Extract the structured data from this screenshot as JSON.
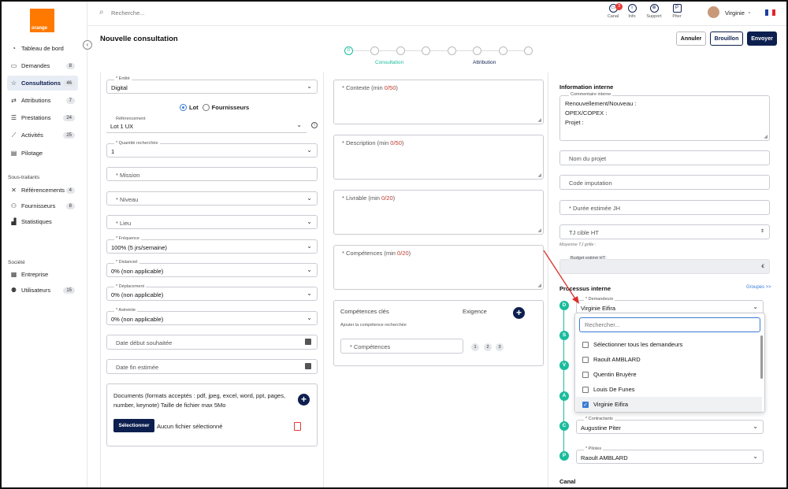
{
  "brand": {
    "logo_text": "orange",
    "accent": "#ff7900",
    "primary": "#0d1f4f",
    "teal": "#1abc9c"
  },
  "sidebar": {
    "items": [
      {
        "label": "Tableau de bord",
        "count": ""
      },
      {
        "label": "Demandes",
        "count": "8"
      },
      {
        "label": "Consultations",
        "count": "46"
      },
      {
        "label": "Attributions",
        "count": "7"
      },
      {
        "label": "Prestations",
        "count": "24"
      },
      {
        "label": "Activités",
        "count": "25"
      },
      {
        "label": "Pilotage",
        "count": ""
      }
    ],
    "section_subcontractors": "Sous-traitants",
    "sub_items": [
      {
        "label": "Référencements",
        "count": "4"
      },
      {
        "label": "Fournisseurs",
        "count": "8"
      },
      {
        "label": "Statistiques",
        "count": ""
      }
    ],
    "section_company": "Société",
    "company_items": [
      {
        "label": "Entreprise",
        "count": ""
      },
      {
        "label": "Utilisateurs",
        "count": "15"
      }
    ]
  },
  "topbar": {
    "search_placeholder": "Recherche...",
    "icons": [
      {
        "label": "Canal",
        "badge": "3"
      },
      {
        "label": "Info"
      },
      {
        "label": "Support"
      },
      {
        "label": "Piter"
      }
    ],
    "user": "Virginie"
  },
  "header": {
    "title": "Nouvelle consultation",
    "cancel": "Annuler",
    "draft": "Brouillon",
    "send": "Envoyer"
  },
  "stepper": {
    "first": "D",
    "label1": "Consultation",
    "label2": "Attribution"
  },
  "form": {
    "entite_label": "* Entité",
    "entite_value": "Digital",
    "radio_lot": "Lot",
    "radio_fournisseurs": "Fournisseurs",
    "referencement_label": "Référencement",
    "referencement_value": "Lot 1 UX",
    "quantite_label": "* Quantité recherchée",
    "quantite_value": "1",
    "mission_ph": "* Mission",
    "niveau_ph": "* Niveau",
    "lieu_ph": "* Lieu",
    "frequence_label": "* Fréquence",
    "frequence_value": "100% (5 jrs/semaine)",
    "distanciel_label": "* Distanciel",
    "distanciel_value": "0% (non applicable)",
    "deplacement_label": "* Déplacement",
    "deplacement_value": "0% (non applicable)",
    "astreinte_label": "* Astreinte",
    "astreinte_value": "0% (non applicable)",
    "date_debut_ph": "Date début souhaitée",
    "date_fin_ph": "Date fin estimée",
    "documents_text": "Documents (formats acceptés : pdf, jpeg, excel, word, ppt, pages, number, keynote) Taille de fichier max 5Mo",
    "select_button": "Sélectionner",
    "no_file": "Aucun fichier sélectionné"
  },
  "middle": {
    "contexte_ph": "* Contexte (min ",
    "contexte_count": "0/50",
    "description_ph": "* Description (min ",
    "description_count": "0/50",
    "livrable_ph": "* Livrable (min ",
    "livrable_count": "0/20",
    "competences_ph": "* Compétences (min ",
    "competences_count": "0/20",
    "close_paren": ")",
    "comp_cles": "Compétences clés",
    "exigence": "Exigence",
    "comp_hint": "Ajouter la compétence recherchée",
    "comp_field_ph": "* Compétences",
    "levels": [
      "1",
      "2",
      "3"
    ]
  },
  "right": {
    "info_title": "Information interne",
    "comment_label": "Commentaire interne",
    "comment_lines": [
      "Renouvellement/Nouveau :",
      "OPEX/COPEX :",
      "Projet :"
    ],
    "nom_projet_ph": "Nom du projet",
    "code_imputation_ph": "Code imputation",
    "duree_ph": "* Durée estimée JH",
    "tj_cible_ph": "TJ cible HT",
    "moyenne": "Moyenne TJ grille :",
    "budget_label": "Budget estimé HT",
    "budget_unit": "€",
    "process_title": "Processus interne",
    "groupes": "Groupes >>",
    "steps": [
      "D",
      "S",
      "V",
      "A",
      "C",
      "P"
    ],
    "demandeurs_label": "* Demandeurs",
    "demandeurs_value": "Virginie Eifira",
    "dropdown_search_ph": "Rechercher...",
    "dropdown_options": [
      {
        "label": "Sélectionner tous les demandeurs",
        "checked": false
      },
      {
        "label": "Raoult AMBLARD",
        "checked": false
      },
      {
        "label": "Quentin Bruyère",
        "checked": false
      },
      {
        "label": "Louis De Funes",
        "checked": false
      },
      {
        "label": "Virginie Eifira",
        "checked": true
      }
    ],
    "contractants_label": "* Contractants",
    "contractants_value": "Augustine Piter",
    "pilotes_label": "* Pilotes",
    "pilotes_value": "Raoult AMBLARD",
    "canal_title": "Canal"
  }
}
